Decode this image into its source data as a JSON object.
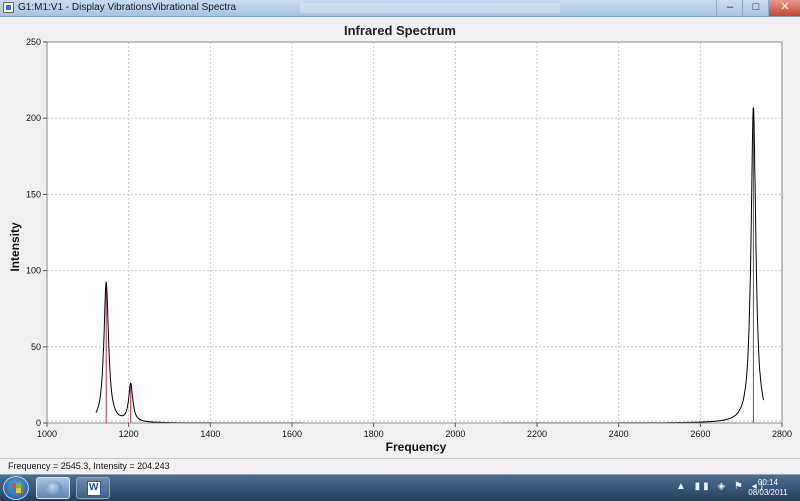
{
  "window": {
    "title": "G1:M1:V1 - Display VibrationsVibrational Spectra",
    "minimize_glyph": "–",
    "maximize_glyph": "□",
    "close_glyph": "✕"
  },
  "status": {
    "text": "Frequency = 2545.3,  Intensity = 204.243"
  },
  "taskbar": {
    "tray_icons": [
      "up-arrow-icon",
      "signal-icon",
      "network-icon",
      "flag-icon",
      "volume-icon"
    ],
    "tray_glyphs": "▲ ▮▮ ◈ ⚑ ◂)",
    "time": "00:14",
    "date": "08/03/2011"
  },
  "colors": {
    "curve": "#000000",
    "sticks": "#b03048",
    "grid": "#c8c8c8",
    "plot_bg": "#ffffff"
  },
  "chart_data": {
    "type": "line",
    "title": "Infrared Spectrum",
    "xlabel": "Frequency",
    "ylabel": "Intensity",
    "xlim": [
      1000,
      2800
    ],
    "ylim": [
      0,
      250
    ],
    "x_ticks": [
      1000,
      1200,
      1400,
      1600,
      1800,
      2000,
      2200,
      2400,
      2600,
      2800
    ],
    "y_ticks": [
      0,
      50,
      100,
      150,
      200,
      250
    ],
    "grid": true,
    "peaks": [
      {
        "x": 1145,
        "y": 92,
        "width": 7
      },
      {
        "x": 1205,
        "y": 25,
        "width": 6
      },
      {
        "x": 2730,
        "y": 207,
        "width": 7
      }
    ],
    "curve_range": [
      1120,
      2755
    ]
  }
}
